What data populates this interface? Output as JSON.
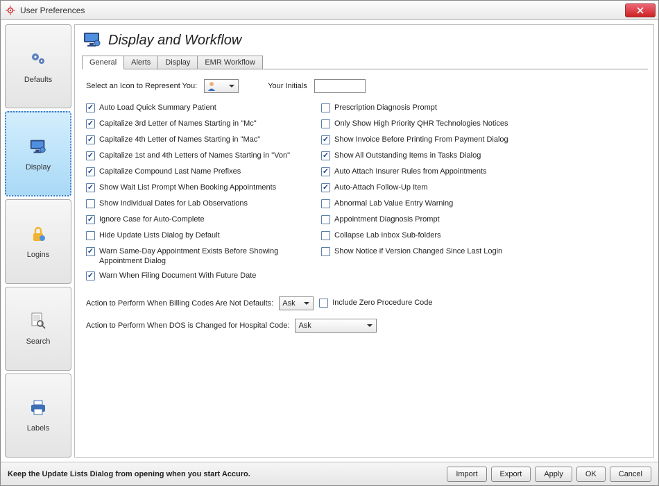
{
  "window": {
    "title": "User Preferences"
  },
  "sidebar": {
    "items": [
      {
        "label": "Defaults"
      },
      {
        "label": "Display"
      },
      {
        "label": "Logins"
      },
      {
        "label": "Search"
      },
      {
        "label": "Labels"
      }
    ],
    "active_index": 1
  },
  "page": {
    "title": "Display and Workflow"
  },
  "tabs": {
    "labels": [
      "General",
      "Alerts",
      "Display",
      "EMR Workflow"
    ],
    "active_index": 0
  },
  "icon_row": {
    "label": "Select an Icon to Represent You:",
    "initials_label": "Your Initials",
    "initials_value": ""
  },
  "options_left": [
    {
      "checked": true,
      "label": "Auto Load Quick Summary Patient"
    },
    {
      "checked": true,
      "label": "Capitalize 3rd Letter of Names Starting in \"Mc\""
    },
    {
      "checked": true,
      "label": "Capitalize 4th Letter of Names Starting in \"Mac\""
    },
    {
      "checked": true,
      "label": "Capitalize 1st and 4th Letters of Names Starting in \"Von\""
    },
    {
      "checked": true,
      "label": "Capitalize Compound Last Name Prefixes"
    },
    {
      "checked": true,
      "label": "Show Wait List Prompt When Booking Appointments"
    },
    {
      "checked": false,
      "label": "Show Individual Dates for Lab Observations"
    },
    {
      "checked": true,
      "label": "Ignore Case for Auto-Complete"
    },
    {
      "checked": false,
      "label": "Hide Update Lists Dialog by Default"
    },
    {
      "checked": true,
      "label": "Warn Same-Day Appointment Exists Before Showing Appointment Dialog"
    },
    {
      "checked": true,
      "label": "Warn When Filing Document With Future Date"
    }
  ],
  "options_right": [
    {
      "checked": false,
      "label": "Prescription Diagnosis Prompt"
    },
    {
      "checked": false,
      "label": "Only Show High Priority QHR Technologies Notices"
    },
    {
      "checked": true,
      "label": "Show Invoice Before Printing From Payment Dialog"
    },
    {
      "checked": true,
      "label": "Show All Outstanding Items in Tasks Dialog"
    },
    {
      "checked": true,
      "label": "Auto Attach Insurer Rules from Appointments"
    },
    {
      "checked": true,
      "label": "Auto-Attach Follow-Up Item"
    },
    {
      "checked": false,
      "label": "Abnormal Lab Value Entry Warning"
    },
    {
      "checked": false,
      "label": "Appointment Diagnosis Prompt"
    },
    {
      "checked": false,
      "label": "Collapse Lab Inbox Sub-folders"
    },
    {
      "checked": false,
      "label": "Show Notice if Version Changed Since Last Login"
    }
  ],
  "action_billing": {
    "label": "Action to Perform When Billing Codes Are Not Defaults:",
    "value": "Ask",
    "include_zero": {
      "checked": false,
      "label": "Include Zero Procedure Code"
    }
  },
  "action_dos": {
    "label": "Action to Perform When DOS is Changed for Hospital Code:",
    "value": "Ask"
  },
  "footer": {
    "hint": "Keep the Update Lists Dialog from opening when you start Accuro.",
    "buttons": [
      "Import",
      "Export",
      "Apply",
      "OK",
      "Cancel"
    ]
  }
}
